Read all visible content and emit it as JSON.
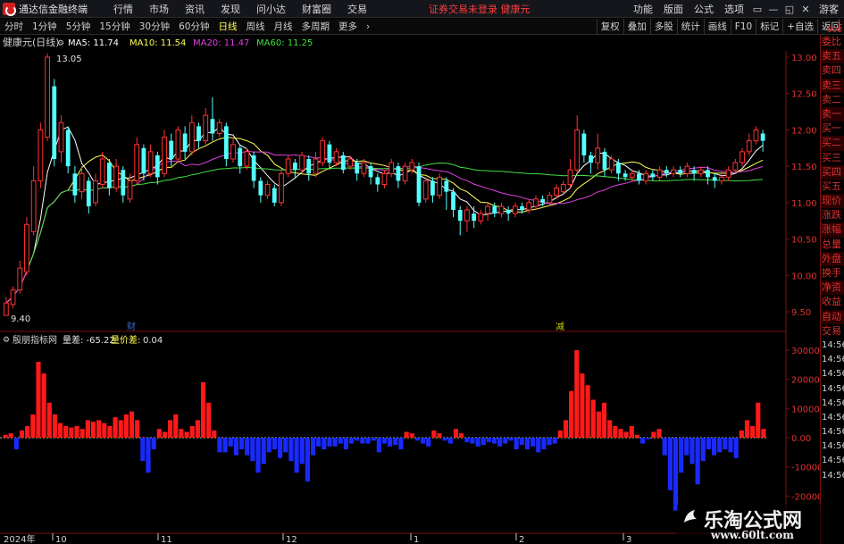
{
  "app": {
    "name": "通达信金融终端"
  },
  "menu": {
    "items": [
      "行情",
      "市场",
      "资讯",
      "发现",
      "问小达",
      "财富圈",
      "交易"
    ],
    "warning": "证券交易未登录   健康元",
    "right_items": [
      "功能",
      "版面",
      "公式",
      "选项"
    ],
    "guest": "游客"
  },
  "toolbar": {
    "periods": [
      "分时",
      "1分钟",
      "5分钟",
      "15分钟",
      "30分钟",
      "60分钟",
      "日线",
      "周线",
      "月线",
      "多周期",
      "更多"
    ],
    "active_period": "日线",
    "right_buttons": [
      "复权",
      "叠加",
      "多股",
      "统计",
      "画线",
      "F10",
      "标记",
      "+自选",
      "返回"
    ]
  },
  "main_panel": {
    "stock_title": "健康元(日线)",
    "ma_labels": [
      {
        "text": "MA5: 11.74",
        "color": "#ffffff"
      },
      {
        "text": "MA10: 11.54",
        "color": "#ffff55"
      },
      {
        "text": "MA20: 11.47",
        "color": "#e040e0"
      },
      {
        "text": "MA60: 11.25",
        "color": "#40e040"
      }
    ],
    "high_label": "13.05",
    "low_label": "9.40",
    "y_ticks": [
      "13.00",
      "12.50",
      "12.00",
      "11.50",
      "11.00",
      "10.50",
      "10.00",
      "9.50"
    ],
    "markers": [
      {
        "text": "财",
        "color": "#3a6ad0"
      },
      {
        "text": "减",
        "color": "#d0d000"
      }
    ]
  },
  "sub_panel": {
    "title": "殷朋指标网",
    "field1": "量差: -65.22",
    "field2_label": "量价差:",
    "field2_value": "0.04",
    "y_ticks": [
      "30000",
      "20000",
      "10000",
      "0.00",
      "-10000",
      "-20000"
    ]
  },
  "x_axis": {
    "labels": [
      "2024年",
      "10",
      "11",
      "12",
      "1",
      "2",
      "3"
    ]
  },
  "side_panel": {
    "label_top": "L\n500",
    "items": [
      "委比",
      "卖五",
      "卖四",
      "卖三",
      "卖二",
      "卖一",
      "买一",
      "买二",
      "买三",
      "买四",
      "买五",
      "现价",
      "涨跌",
      "涨幅",
      "总量",
      "外盘",
      "换手",
      "净资",
      "收益",
      "自动",
      "交易"
    ],
    "times": [
      "14:56",
      "14:56",
      "14:56",
      "14:56",
      "14:56",
      "14:56",
      "14:56",
      "14:56",
      "14:56",
      "14:56"
    ]
  },
  "watermark": {
    "title": "乐淘公式网",
    "url": "www.60lt.com"
  },
  "colors": {
    "up": "#ff3232",
    "down": "#54ffff",
    "ma5": "#ffffff",
    "ma10": "#ffff55",
    "ma20": "#e040e0",
    "ma60": "#40e040",
    "pos_bar": "#ff1a1a",
    "neg_bar": "#1a2aff",
    "axis": "#7a1010",
    "grid": "#5a0000"
  },
  "chart_data": [
    {
      "type": "candlestick",
      "title": "健康元(日线)",
      "ylim": [
        9.4,
        13.2
      ],
      "x_tick_labels": [
        "2024年",
        "10",
        "11",
        "12",
        "1",
        "2",
        "3"
      ],
      "candles": [
        [
          9.45,
          9.62,
          9.55,
          9.7
        ],
        [
          9.6,
          9.8,
          9.55,
          9.85
        ],
        [
          9.8,
          10.1,
          9.75,
          10.2
        ],
        [
          10.05,
          10.7,
          10.0,
          10.8
        ],
        [
          10.6,
          11.3,
          10.55,
          11.5
        ],
        [
          11.3,
          12.0,
          11.2,
          12.1
        ],
        [
          11.9,
          13.0,
          11.85,
          13.05
        ],
        [
          12.6,
          11.6,
          11.5,
          12.7
        ],
        [
          11.7,
          12.1,
          11.55,
          12.2
        ],
        [
          12.0,
          11.5,
          11.4,
          12.05
        ],
        [
          11.4,
          11.1,
          11.0,
          11.5
        ],
        [
          11.15,
          11.4,
          11.05,
          11.5
        ],
        [
          11.3,
          10.95,
          10.85,
          11.35
        ],
        [
          11.0,
          11.3,
          10.95,
          11.4
        ],
        [
          11.25,
          11.6,
          11.2,
          11.7
        ],
        [
          11.55,
          11.2,
          11.1,
          11.6
        ],
        [
          11.2,
          11.5,
          11.15,
          11.6
        ],
        [
          11.45,
          11.1,
          11.0,
          11.5
        ],
        [
          11.05,
          11.3,
          11.0,
          11.4
        ],
        [
          11.3,
          11.8,
          11.25,
          11.9
        ],
        [
          11.75,
          11.4,
          11.3,
          11.8
        ],
        [
          11.4,
          11.7,
          11.35,
          11.8
        ],
        [
          11.65,
          11.35,
          11.25,
          11.7
        ],
        [
          11.4,
          11.9,
          11.35,
          12.0
        ],
        [
          11.85,
          11.6,
          11.5,
          11.95
        ],
        [
          11.6,
          12.0,
          11.55,
          12.05
        ],
        [
          11.95,
          11.7,
          11.6,
          12.05
        ],
        [
          11.7,
          12.1,
          11.65,
          12.2
        ],
        [
          12.05,
          11.85,
          11.75,
          12.1
        ],
        [
          11.85,
          12.2,
          11.8,
          12.3
        ],
        [
          12.15,
          11.95,
          11.85,
          12.45
        ],
        [
          11.95,
          12.1,
          11.9,
          12.15
        ],
        [
          12.05,
          11.6,
          11.5,
          12.1
        ],
        [
          11.6,
          11.8,
          11.55,
          11.9
        ],
        [
          11.75,
          11.5,
          11.4,
          11.8
        ],
        [
          11.5,
          11.7,
          11.45,
          11.75
        ],
        [
          11.65,
          11.3,
          11.2,
          11.7
        ],
        [
          11.3,
          11.1,
          11.0,
          11.35
        ],
        [
          11.1,
          11.25,
          11.05,
          11.3
        ],
        [
          11.2,
          11.0,
          10.95,
          11.25
        ],
        [
          11.0,
          11.4,
          10.95,
          11.45
        ],
        [
          11.4,
          11.6,
          11.35,
          11.65
        ],
        [
          11.55,
          11.45,
          11.35,
          11.6
        ],
        [
          11.45,
          11.65,
          11.4,
          11.7
        ],
        [
          11.6,
          11.4,
          11.3,
          11.65
        ],
        [
          11.4,
          11.6,
          11.35,
          11.7
        ],
        [
          11.55,
          11.85,
          11.5,
          11.9
        ],
        [
          11.8,
          11.55,
          11.45,
          11.85
        ],
        [
          11.55,
          11.7,
          11.5,
          11.75
        ],
        [
          11.65,
          11.45,
          11.4,
          11.7
        ],
        [
          11.5,
          11.6,
          11.45,
          11.65
        ],
        [
          11.55,
          11.4,
          11.3,
          11.6
        ],
        [
          11.4,
          11.55,
          11.35,
          11.6
        ],
        [
          11.5,
          11.35,
          11.25,
          11.55
        ],
        [
          11.35,
          11.25,
          11.15,
          11.4
        ],
        [
          11.25,
          11.4,
          11.2,
          11.45
        ],
        [
          11.4,
          11.55,
          11.35,
          11.6
        ],
        [
          11.5,
          11.3,
          11.2,
          11.55
        ],
        [
          11.3,
          11.5,
          11.25,
          11.55
        ],
        [
          11.45,
          11.55,
          11.4,
          11.6
        ],
        [
          11.5,
          11.0,
          10.95,
          11.55
        ],
        [
          11.05,
          11.3,
          11.0,
          11.35
        ],
        [
          11.3,
          11.1,
          11.0,
          11.35
        ],
        [
          11.1,
          11.35,
          11.05,
          11.4
        ],
        [
          11.3,
          11.15,
          10.9,
          11.35
        ],
        [
          11.15,
          10.9,
          10.8,
          11.2
        ],
        [
          10.9,
          10.75,
          10.55,
          10.95
        ],
        [
          10.75,
          10.9,
          10.6,
          10.95
        ],
        [
          10.85,
          10.75,
          10.65,
          10.95
        ],
        [
          10.75,
          10.85,
          10.7,
          10.9
        ],
        [
          10.85,
          10.95,
          10.75,
          11.0
        ],
        [
          10.95,
          10.85,
          10.8,
          11.0
        ],
        [
          10.85,
          10.95,
          10.8,
          11.0
        ],
        [
          10.9,
          10.85,
          10.75,
          10.95
        ],
        [
          10.85,
          10.95,
          10.8,
          11.0
        ],
        [
          10.95,
          10.9,
          10.85,
          11.0
        ],
        [
          10.9,
          11.0,
          10.85,
          11.05
        ],
        [
          10.95,
          11.05,
          10.9,
          11.1
        ],
        [
          11.05,
          11.0,
          10.95,
          11.1
        ],
        [
          11.0,
          11.1,
          10.95,
          11.15
        ],
        [
          11.1,
          11.2,
          11.05,
          11.25
        ],
        [
          11.15,
          11.25,
          11.1,
          11.3
        ],
        [
          11.25,
          11.45,
          11.2,
          11.6
        ],
        [
          11.45,
          12.0,
          11.4,
          12.2
        ],
        [
          11.95,
          11.65,
          11.55,
          12.0
        ],
        [
          11.65,
          11.55,
          11.4,
          11.7
        ],
        [
          11.55,
          11.75,
          11.45,
          11.95
        ],
        [
          11.7,
          11.45,
          11.35,
          11.75
        ],
        [
          11.45,
          11.6,
          11.4,
          11.65
        ],
        [
          11.55,
          11.4,
          11.3,
          11.6
        ],
        [
          11.4,
          11.35,
          11.3,
          11.45
        ],
        [
          11.35,
          11.4,
          11.3,
          11.45
        ],
        [
          11.4,
          11.3,
          11.25,
          11.45
        ],
        [
          11.3,
          11.4,
          11.25,
          11.45
        ],
        [
          11.4,
          11.35,
          11.3,
          11.45
        ],
        [
          11.35,
          11.45,
          11.3,
          11.5
        ],
        [
          11.45,
          11.4,
          11.35,
          11.5
        ],
        [
          11.4,
          11.45,
          11.35,
          11.5
        ],
        [
          11.45,
          11.4,
          11.35,
          11.5
        ],
        [
          11.4,
          11.5,
          11.35,
          11.55
        ],
        [
          11.45,
          11.4,
          11.3,
          11.5
        ],
        [
          11.4,
          11.45,
          11.35,
          11.5
        ],
        [
          11.45,
          11.35,
          11.25,
          11.5
        ],
        [
          11.35,
          11.3,
          11.2,
          11.4
        ],
        [
          11.3,
          11.35,
          11.25,
          11.4
        ],
        [
          11.35,
          11.45,
          11.3,
          11.5
        ],
        [
          11.45,
          11.55,
          11.4,
          11.6
        ],
        [
          11.55,
          11.7,
          11.5,
          11.75
        ],
        [
          11.7,
          11.85,
          11.65,
          11.95
        ],
        [
          11.85,
          12.0,
          11.8,
          12.05
        ],
        [
          11.95,
          11.85,
          11.7,
          12.0
        ]
      ],
      "series": [
        {
          "name": "MA5",
          "value": 11.74
        },
        {
          "name": "MA10",
          "value": 11.54
        },
        {
          "name": "MA20",
          "value": 11.47
        },
        {
          "name": "MA60",
          "value": 11.25
        }
      ]
    },
    {
      "type": "bar",
      "title": "殷朋指标网",
      "ylim": [
        -25000,
        32000
      ],
      "values": [
        1000,
        1500,
        -4000,
        2500,
        4000,
        8000,
        26000,
        22000,
        12000,
        8000,
        5000,
        4000,
        3500,
        4000,
        3000,
        6000,
        5500,
        6000,
        5000,
        4000,
        7000,
        6000,
        8000,
        9000,
        6000,
        -8000,
        -12000,
        -4000,
        3000,
        2000,
        6000,
        8000,
        3000,
        2000,
        4000,
        6000,
        19000,
        12000,
        2500,
        -5000,
        -5000,
        -3000,
        -6000,
        -4000,
        -6000,
        -8000,
        -12000,
        -9000,
        -5000,
        -4000,
        -7000,
        -5000,
        -8000,
        -12000,
        -9000,
        -15000,
        -6000,
        -3000,
        -4000,
        -3000,
        -3000,
        -2000,
        -4000,
        -2000,
        -1000,
        -2000,
        -2000,
        -1000,
        -5000,
        -2000,
        -3000,
        -2500,
        -4000,
        2000,
        1500,
        -1000,
        -2000,
        -3000,
        2500,
        1500,
        -1000,
        -2000,
        3000,
        1500,
        -1500,
        -2000,
        -3000,
        -2500,
        -1500,
        -2000,
        -3000,
        -2000,
        -1000,
        -4000,
        -2500,
        -4000,
        -3000,
        -5000,
        -4000,
        -2500,
        -2000,
        2500,
        6000,
        16000,
        30000,
        22000,
        18000,
        13000,
        9000,
        12000,
        6000,
        4000,
        3000,
        2000,
        4000,
        1000,
        -2000,
        -500,
        2000,
        3000,
        -6000,
        -18000,
        -25000,
        -12000,
        -6000,
        -9000,
        -16000,
        -8000,
        -4000,
        -6000,
        -5000,
        -4000,
        -5000,
        -7000,
        2500,
        6000,
        4000,
        12000,
        3000
      ]
    }
  ]
}
